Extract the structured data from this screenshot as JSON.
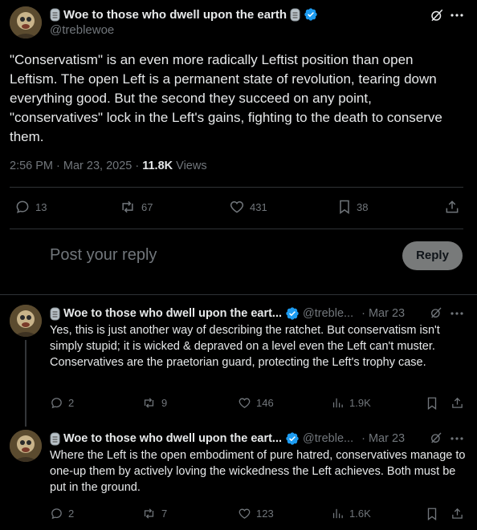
{
  "main_post": {
    "author_name": "Woe to those who dwell upon the earth",
    "handle": "@treblewoe",
    "text": "\"Conservatism\" is an even more radically Leftist position than open Leftism. The open Left is a permanent state of revolution, tearing down everything good. But the second they succeed on any point, \"conservatives\" lock in the Left's gains, fighting to the death to conserve them.",
    "timestamp": "2:56 PM · Mar 23, 2025 · ",
    "views_count": "11.8K",
    "views_label": " Views",
    "replies": "13",
    "reposts": "67",
    "likes": "431",
    "bookmarks": "38"
  },
  "composer": {
    "placeholder": "Post your reply",
    "button": "Reply"
  },
  "replies": [
    {
      "author_name": "Woe to those who dwell upon the eart...",
      "handle": "@treble...",
      "date": "· Mar 23",
      "text": "Yes, this is just another way of describing the ratchet. But conservatism isn't simply stupid; it is wicked & depraved on a level even the Left can't muster. Conservatives are the praetorian guard, protecting the Left's trophy case.",
      "replies": "2",
      "reposts": "9",
      "likes": "146",
      "views": "1.9K"
    },
    {
      "author_name": "Woe to those who dwell upon the eart...",
      "handle": "@treble...",
      "date": "· Mar 23",
      "text": "Where the Left is the open embodiment of pure hatred, conservatives manage to one-up them by actively loving the wickedness the Left achieves. Both must be put in the ground.",
      "replies": "2",
      "reposts": "7",
      "likes": "123",
      "views": "1.6K"
    }
  ],
  "colors": {
    "background": "#000000",
    "text": "#e7e9ea",
    "muted": "#71767b",
    "verified": "#1d9bf0",
    "divider": "#2f3336",
    "reply_button": "#eff3f4"
  },
  "icons": [
    "verified-badge-icon",
    "stone-tablet-icon",
    "grok-icon",
    "more-icon",
    "reply-icon",
    "repost-icon",
    "like-icon",
    "bookmark-icon",
    "share-icon",
    "views-icon"
  ]
}
